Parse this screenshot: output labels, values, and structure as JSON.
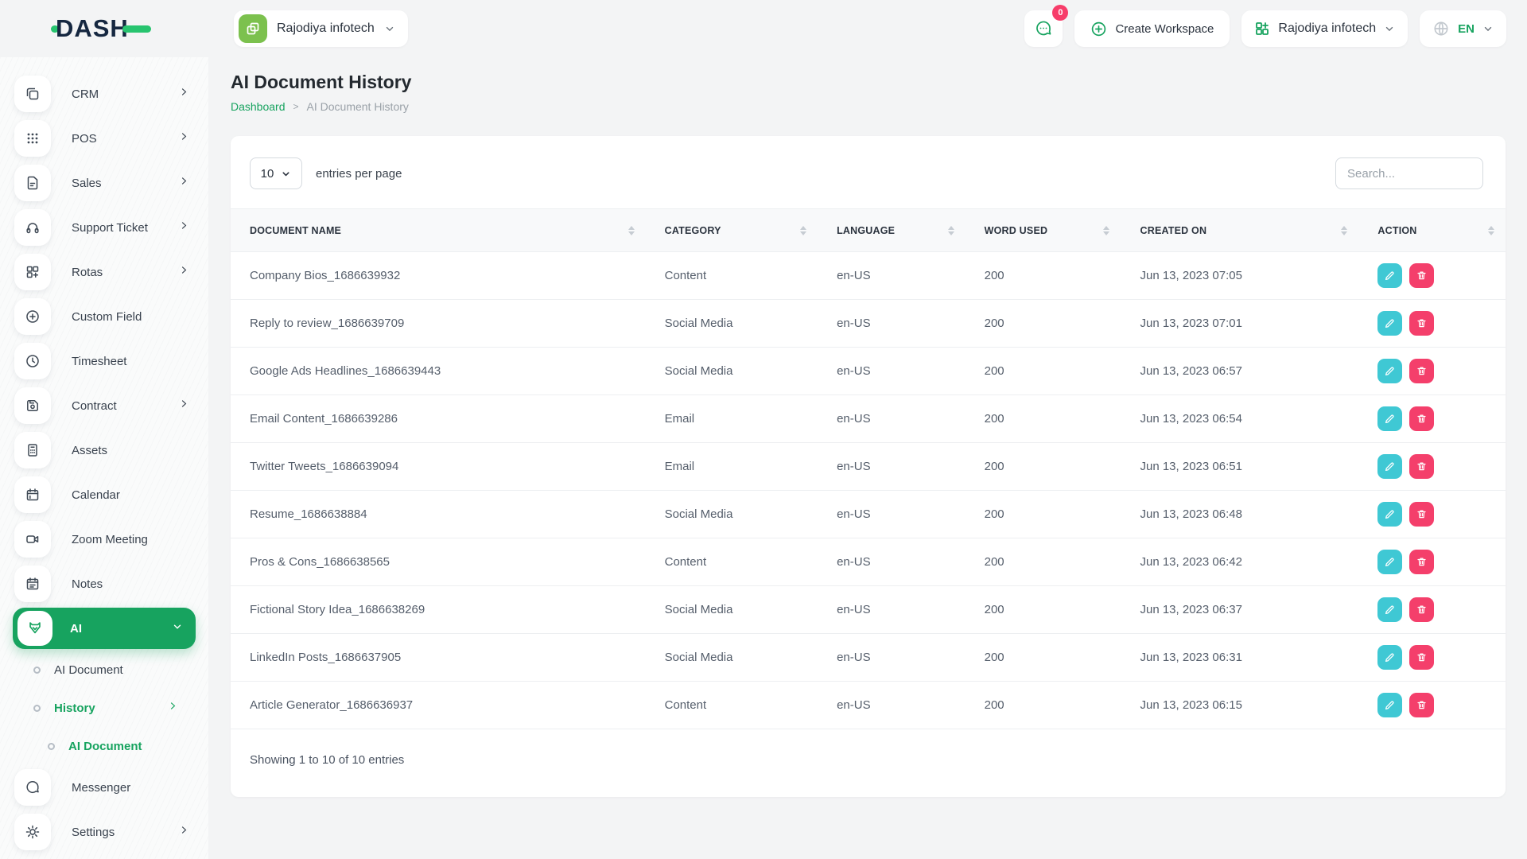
{
  "header": {
    "logo": "DASH",
    "workspace_pill": "Rajodiya infotech",
    "chat_badge": "0",
    "create_workspace": "Create Workspace",
    "account_pill": "Rajodiya infotech",
    "language": "EN"
  },
  "page": {
    "title": "AI Document History",
    "breadcrumb": [
      "Dashboard",
      "AI Document History"
    ]
  },
  "sidebar": {
    "items": [
      {
        "label": "CRM"
      },
      {
        "label": "POS"
      },
      {
        "label": "Sales"
      },
      {
        "label": "Support Ticket"
      },
      {
        "label": "Rotas"
      },
      {
        "label": "Custom Field"
      },
      {
        "label": "Timesheet"
      },
      {
        "label": "Contract"
      },
      {
        "label": "Assets"
      },
      {
        "label": "Calendar"
      },
      {
        "label": "Zoom Meeting"
      },
      {
        "label": "Notes"
      },
      {
        "label": "AI"
      },
      {
        "label": "AI Document"
      },
      {
        "label": "History"
      },
      {
        "label": "AI Document"
      },
      {
        "label": "Messenger"
      },
      {
        "label": "Settings"
      }
    ]
  },
  "toolbar": {
    "page_size": "10",
    "entries_label": "entries per page",
    "search_placeholder": "Search..."
  },
  "table": {
    "columns": [
      "DOCUMENT NAME",
      "CATEGORY",
      "LANGUAGE",
      "WORD USED",
      "CREATED ON",
      "ACTION"
    ],
    "rows": [
      {
        "name": "Company Bios_1686639932",
        "category": "Content",
        "language": "en-US",
        "words": "200",
        "created": "Jun 13, 2023 07:05"
      },
      {
        "name": "Reply to review_1686639709",
        "category": "Social Media",
        "language": "en-US",
        "words": "200",
        "created": "Jun 13, 2023 07:01"
      },
      {
        "name": "Google Ads Headlines_1686639443",
        "category": "Social Media",
        "language": "en-US",
        "words": "200",
        "created": "Jun 13, 2023 06:57"
      },
      {
        "name": "Email Content_1686639286",
        "category": "Email",
        "language": "en-US",
        "words": "200",
        "created": "Jun 13, 2023 06:54"
      },
      {
        "name": "Twitter Tweets_1686639094",
        "category": "Email",
        "language": "en-US",
        "words": "200",
        "created": "Jun 13, 2023 06:51"
      },
      {
        "name": "Resume_1686638884",
        "category": "Social Media",
        "language": "en-US",
        "words": "200",
        "created": "Jun 13, 2023 06:48"
      },
      {
        "name": "Pros & Cons_1686638565",
        "category": "Content",
        "language": "en-US",
        "words": "200",
        "created": "Jun 13, 2023 06:42"
      },
      {
        "name": "Fictional Story Idea_1686638269",
        "category": "Social Media",
        "language": "en-US",
        "words": "200",
        "created": "Jun 13, 2023 06:37"
      },
      {
        "name": "LinkedIn Posts_1686637905",
        "category": "Social Media",
        "language": "en-US",
        "words": "200",
        "created": "Jun 13, 2023 06:31"
      },
      {
        "name": "Article Generator_1686636937",
        "category": "Content",
        "language": "en-US",
        "words": "200",
        "created": "Jun 13, 2023 06:15"
      }
    ],
    "footer": "Showing 1 to 10 of 10 entries"
  },
  "colors": {
    "accent_green": "#17a35f",
    "logo_green": "#27c46f",
    "edit_teal": "#3fc8d4",
    "delete_pink": "#f43f6b",
    "badge_pink": "#f73d6a"
  }
}
